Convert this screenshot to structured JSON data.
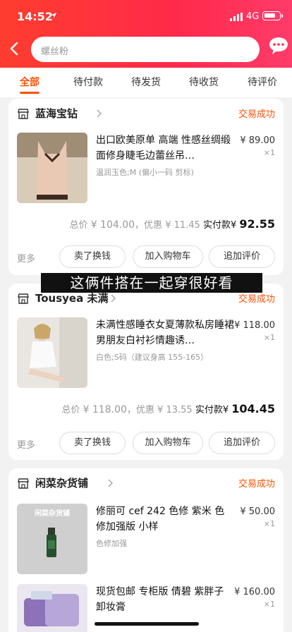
{
  "status_bar": {
    "time": "14:52",
    "network": "4G",
    "battery_level": 0.8
  },
  "search": {
    "placeholder": "螺丝粉"
  },
  "tabs": [
    {
      "label": "全部",
      "active": true
    },
    {
      "label": "待付款"
    },
    {
      "label": "待发货"
    },
    {
      "label": "待收货"
    },
    {
      "label": "待评价"
    }
  ],
  "caption": "这俩件搭在一起穿很好看",
  "orders": [
    {
      "shop": "蓝海宝钻",
      "status": "交易成功",
      "item": {
        "title": "出口欧美原单 高端 性感丝绸缎面修身睫毛边蕾丝吊…",
        "sku": "温润玉色;M (偏小一码 剪标)",
        "price": "¥ 89.00",
        "qty": "×1"
      },
      "total": {
        "label": "总价",
        "amount": "¥ 104.00",
        "discount_label": "，优惠",
        "discount": "¥ 11.45",
        "pay_label": "实付款",
        "pay_currency": "¥",
        "pay_amount": "92.55"
      },
      "more": "更多",
      "buttons": [
        "卖了换钱",
        "加入购物车",
        "追加评价"
      ]
    },
    {
      "shop": "Tousyea 未满",
      "status": "交易成功",
      "item": {
        "title": "未满性感睡衣女夏薄款私房睡裙男朋友白衬衫情趣诱…",
        "sku": "白色;S码（建议身高 155-165）",
        "price": "¥ 118.00",
        "qty": "×1"
      },
      "total": {
        "label": "总价",
        "amount": "¥ 118.00",
        "discount_label": "，优惠",
        "discount": "¥ 13.55",
        "pay_label": "实付款",
        "pay_currency": "¥",
        "pay_amount": "104.45"
      },
      "more": "更多",
      "buttons": [
        "卖了换钱",
        "加入购物车",
        "追加评价"
      ]
    },
    {
      "shop": "闲菜杂货铺",
      "status": "交易成功",
      "items": [
        {
          "title": "修丽可 cef 242 色修 紫米 色修加强版 小样",
          "sku": "色修加强",
          "price": "¥ 50.00",
          "qty": "×1",
          "thumb_text": "闲菜杂货铺"
        },
        {
          "title": "现货包邮 专柜版 倩碧 紫胖子 卸妆膏",
          "price": "¥ 160.00",
          "qty": "×1"
        }
      ]
    }
  ],
  "colors": {
    "accent": "#ff5000",
    "header": "#ff2a4a"
  }
}
